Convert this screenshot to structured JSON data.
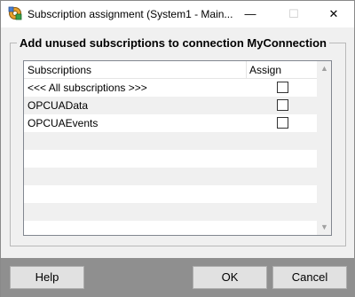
{
  "window": {
    "title": "Subscription assignment (System1 - Main...",
    "minimize_glyph": "—",
    "maximize_glyph": "☐",
    "close_glyph": "✕",
    "app_icon": "gear-network-icon"
  },
  "group": {
    "title": "Add unused subscriptions to connection MyConnection"
  },
  "grid": {
    "columns": [
      "Subscriptions",
      "Assign"
    ],
    "rows": [
      {
        "name": "<<< All subscriptions >>>",
        "assigned": false
      },
      {
        "name": "OPCUAData",
        "assigned": false
      },
      {
        "name": "OPCUAEvents",
        "assigned": false
      }
    ],
    "scroll_up_glyph": "▲",
    "scroll_down_glyph": "▼"
  },
  "buttons": {
    "help": "Help",
    "ok": "OK",
    "cancel": "Cancel"
  },
  "colors": {
    "titlebar": "#ffffff",
    "dialog_bg": "#f0f0f0",
    "alt_row": "#f0f0f0",
    "bottom_bar": "#8f8f8f",
    "button_face": "#e1e1e1"
  }
}
